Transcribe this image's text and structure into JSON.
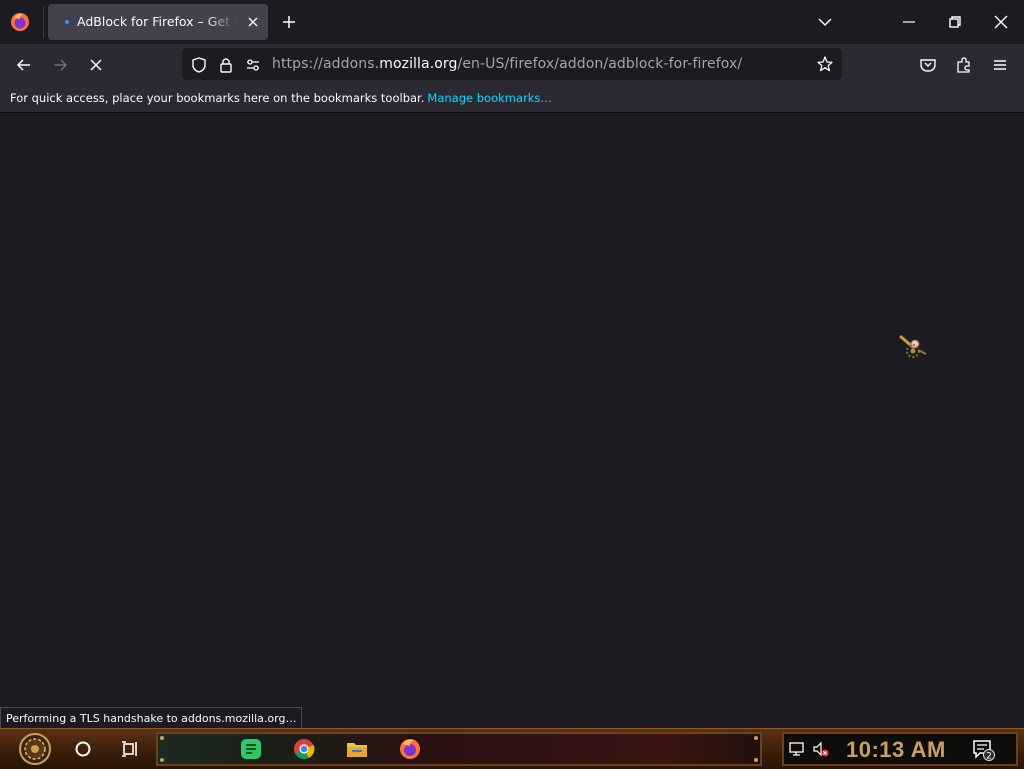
{
  "browser": {
    "tab_title": "AdBlock for Firefox – Get this Extension for Firefox (en-US)",
    "url": {
      "scheme": "https://addons.",
      "host": "mozilla.org",
      "path": "/en-US/firefox/addon/adblock-for-firefox/"
    },
    "bookmarks_bar": {
      "message": "For quick access, place your bookmarks here on the bookmarks toolbar.",
      "link": "Manage bookmarks…"
    },
    "status_text": "Performing a TLS handshake to addons.mozilla.org…",
    "loading": true
  },
  "taskbar": {
    "clock": "10:13 AM",
    "notification_count": "2",
    "pinned_apps": [
      "search-icon",
      "task-view-icon",
      "notes-app-icon",
      "chrome-icon",
      "file-explorer-icon",
      "firefox-icon"
    ]
  },
  "colors": {
    "accent_link": "#00ddff",
    "tab_active": "#42414d",
    "toolbar": "#2b2a33",
    "content_bg": "#1c1b22",
    "clock": "#c8a066"
  }
}
